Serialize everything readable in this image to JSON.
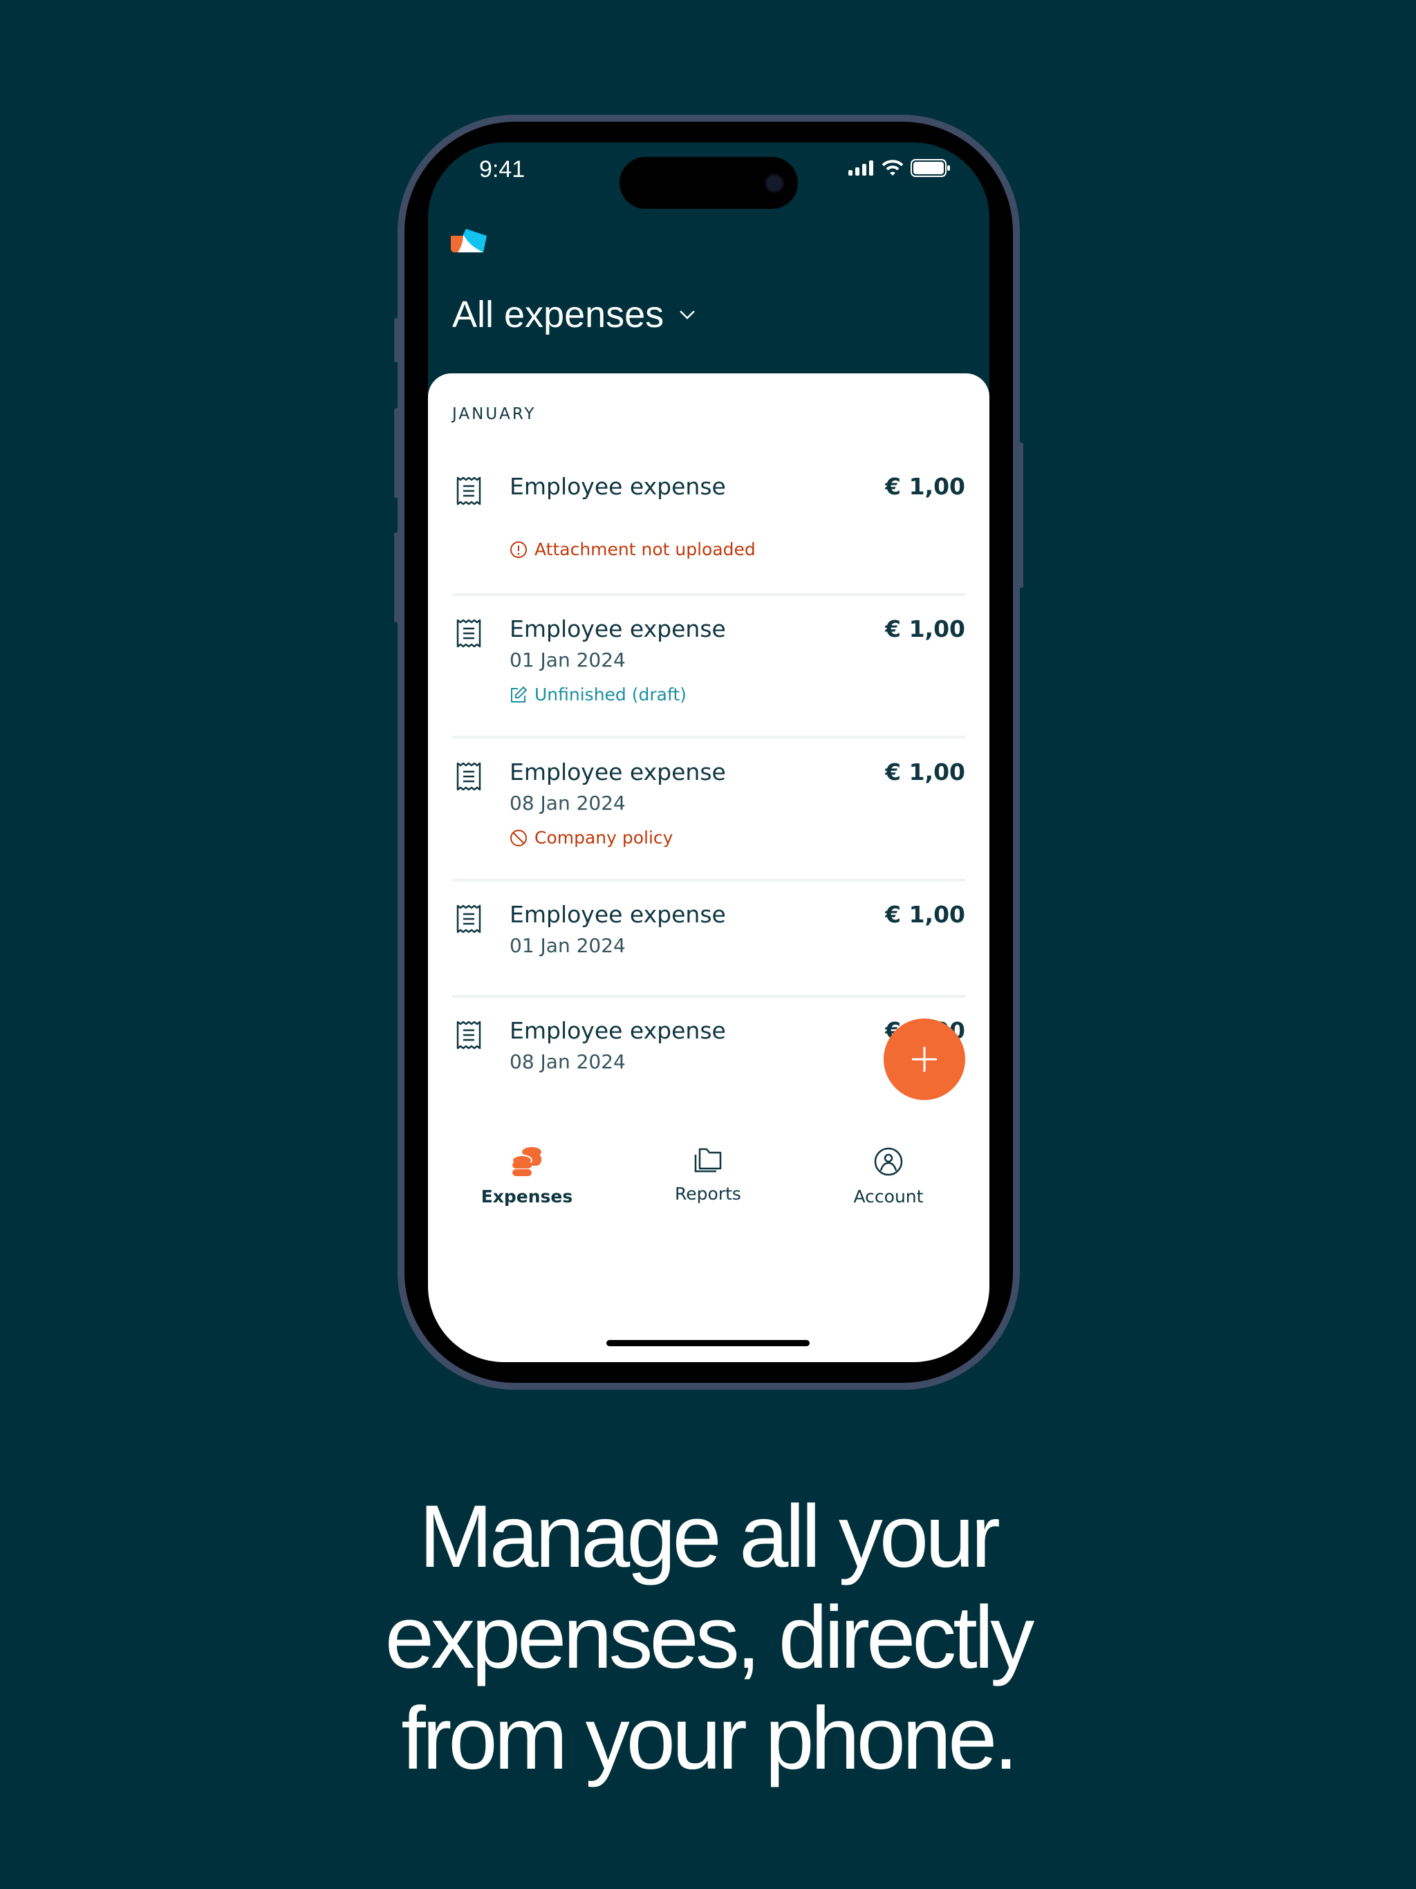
{
  "status_bar": {
    "time": "9:41",
    "icons": [
      "signal-icon",
      "wifi-icon",
      "battery-icon"
    ]
  },
  "header": {
    "title": "All expenses",
    "chevron": "chevron-down-icon"
  },
  "section": {
    "month": "JANUARY"
  },
  "expenses": [
    {
      "title": "Employee expense",
      "amount": "€ 1,00",
      "date": "",
      "status": "Attachment not uploaded",
      "status_type": "warning"
    },
    {
      "title": "Employee expense",
      "amount": "€ 1,00",
      "date": "01 Jan 2024",
      "status": "Unfinished (draft)",
      "status_type": "draft"
    },
    {
      "title": "Employee expense",
      "amount": "€ 1,00",
      "date": "08 Jan 2024",
      "status": "Company policy",
      "status_type": "policy"
    },
    {
      "title": "Employee expense",
      "amount": "€ 1,00",
      "date": "01 Jan 2024",
      "status": "",
      "status_type": ""
    },
    {
      "title": "Employee expense",
      "amount": "€ 1,00",
      "date": "08 Jan 2024",
      "status": "",
      "status_type": ""
    }
  ],
  "fab": {
    "icon": "plus-icon"
  },
  "tabs": [
    {
      "label": "Expenses",
      "icon": "coins-icon",
      "active": true
    },
    {
      "label": "Reports",
      "icon": "folders-icon",
      "active": false
    },
    {
      "label": "Account",
      "icon": "user-circle-icon",
      "active": false
    }
  ],
  "tagline": [
    "Manage all your",
    "expenses, directly",
    "from your phone."
  ],
  "colors": {
    "background": "#00303b",
    "accent": "#f26b33",
    "warning": "#c0390b",
    "draft": "#1a8fa0",
    "text": "#0f3640"
  }
}
